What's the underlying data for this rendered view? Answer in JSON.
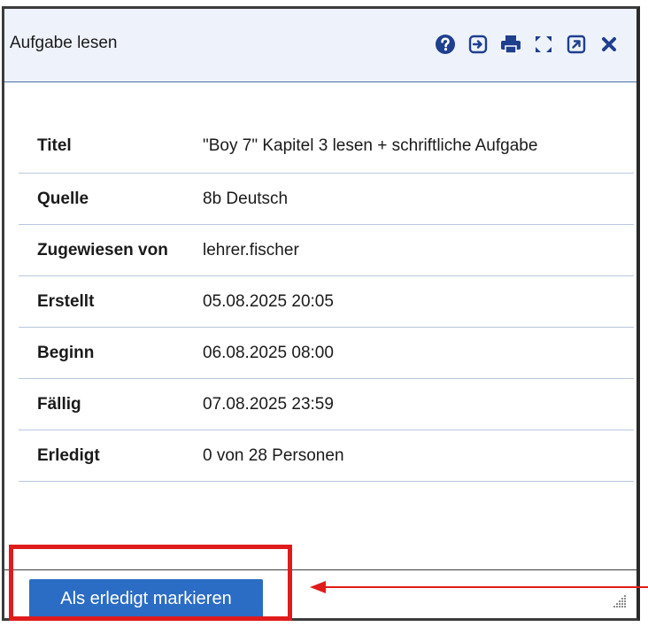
{
  "dialog": {
    "title": "Aufgabe lesen",
    "toolbar": [
      {
        "name": "help-icon"
      },
      {
        "name": "open-in-icon"
      },
      {
        "name": "print-icon"
      },
      {
        "name": "fullscreen-icon"
      },
      {
        "name": "external-link-icon"
      },
      {
        "name": "close-icon"
      }
    ],
    "accent_color": "#2b6cc4",
    "highlight_color": "#e01b1b"
  },
  "details": [
    {
      "label": "Titel",
      "value": "\"Boy 7\" Kapitel 3 lesen + schriftliche Aufgabe"
    },
    {
      "label": "Quelle",
      "value": "8b Deutsch"
    },
    {
      "label": "Zugewiesen von",
      "value": "lehrer.fischer"
    },
    {
      "label": "Erstellt",
      "value": "05.08.2025 20:05"
    },
    {
      "label": "Beginn",
      "value": "06.08.2025 08:00"
    },
    {
      "label": "Fällig",
      "value": "07.08.2025 23:59"
    },
    {
      "label": "Erledigt",
      "value": "0 von 28 Personen"
    }
  ],
  "footer": {
    "primary_button": "Als erledigt markieren"
  }
}
